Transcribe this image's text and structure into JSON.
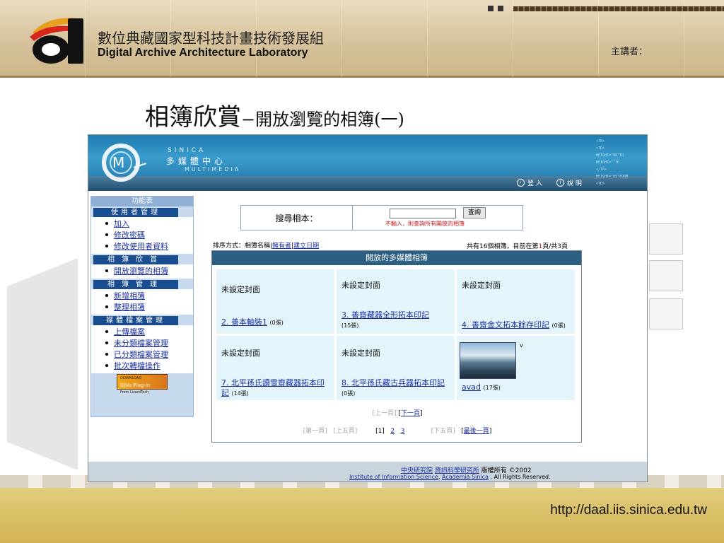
{
  "slide": {
    "lab_name_zh": "數位典藏國家型科技計畫技術發展組",
    "lab_name_en": "Digital Archive Architecture Laboratory",
    "speaker_label": "主講者：",
    "title_main": "相簿欣賞",
    "title_sub": "−開放瀏覽的相簿(一)",
    "url": "http://daal.iis.sinica.edu.tw"
  },
  "site": {
    "brand_sinica": "SINICA",
    "brand_name": "多媒體中心",
    "brand_multimedia": "MULTIMEDIA",
    "login_label": "登 入",
    "help_label": "說 明",
    "codes": [
      "<TR>",
      "<TD>",
      "HEIGHT=\"80\"TD",
      "HEIGHT=\"\"TD",
      "</TR>",
      "HEIGHT=\"85\"FORM",
      "<TD>"
    ]
  },
  "sidebar": {
    "title": "功能表",
    "sections": [
      {
        "heading": "使用者管理",
        "items": [
          "加入",
          "修改密碼",
          "修改使用者資料"
        ]
      },
      {
        "heading": "相簿欣賞",
        "items": [
          "開放瀏覽的相簿"
        ]
      },
      {
        "heading": "相簿管理",
        "items": [
          "新增相簿",
          "整理相簿"
        ]
      },
      {
        "heading": "媒體檔案管理",
        "items": [
          "上傳檔案",
          "未分類檔案管理",
          "已分類檔案管理",
          "批次轉檔操作"
        ]
      }
    ],
    "download_label": "DOWNLOAD",
    "djvu_label": "DjVu Plug-in",
    "djvu_sub": "From LizardTech"
  },
  "search": {
    "label": "搜尋相本：",
    "value": "",
    "button": "查詢",
    "hint": "不輸入，則查詢所有開放的相簿"
  },
  "sort": {
    "prefix": "排序方式：相簿名稱|",
    "owner": "擁有者",
    "sep": "|",
    "created": "建立日期"
  },
  "count": {
    "pre": "共有16個相簿，目前在第",
    "page": "1",
    "post": "頁/共3頁"
  },
  "album": {
    "header": "開放的多媒體相簿",
    "cells": [
      {
        "cover": "未設定封面",
        "title": "2. 善本軸裝1",
        "count": "(0張)"
      },
      {
        "cover": "未設定封面",
        "title": "3. 善齋藏器全形拓本印記",
        "count": "(15張)"
      },
      {
        "cover": "未設定封面",
        "title": "4. 善齋金文拓本餘存印記",
        "count": "(0張)"
      },
      {
        "cover": "未設定封面",
        "title": "7. 北平孫氏讀雪齋藏器拓本印記",
        "count": "(14張)"
      },
      {
        "cover": "未設定封面",
        "title": "8. 北平孫氏藏古兵器拓本印記",
        "count": "(0張)"
      },
      {
        "cover": "",
        "mark": "v",
        "title": "avad",
        "count": "(17張)"
      }
    ],
    "pager1": {
      "prev": "[上一頁]",
      "next": "下一頁"
    },
    "pager2": {
      "first": "[第一頁]",
      "prev5": "[上五頁]",
      "p1": "[1]",
      "p2": "2",
      "p3": "3",
      "next5": "[下五頁]",
      "last": "最後一頁"
    }
  },
  "footer": {
    "org1": "中央研究院",
    "org2": "資訊科學研究所",
    "rights_zh": "版權所有 ©2002",
    "inst_en": "Institute of Information Science",
    "comma": ",",
    "sinica_en": "Academia Sinica",
    "rights_en": ". All Rights Reserved."
  }
}
